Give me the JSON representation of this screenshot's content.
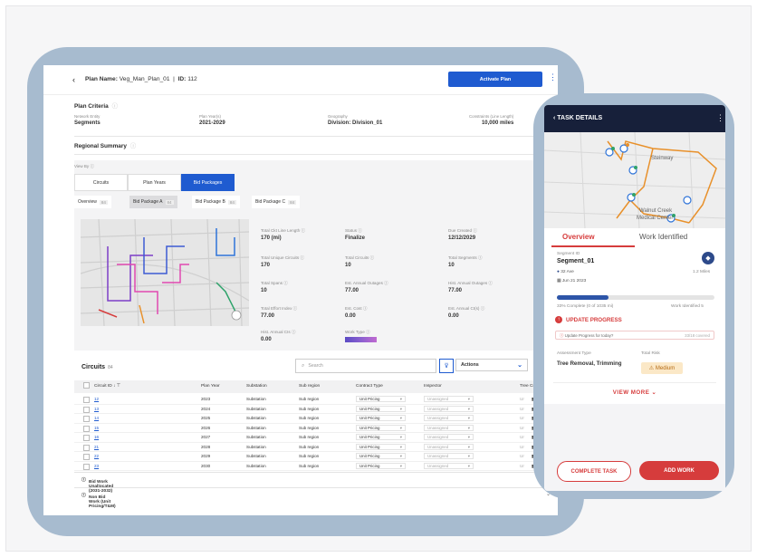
{
  "plan": {
    "back_icon": "chevron-left-icon",
    "name_label": "Plan Name:",
    "name_value": "Veg_Man_Plan_01",
    "id_label": "ID:",
    "id_value": "112",
    "activate_label": "Activate Plan"
  },
  "criteria": {
    "title": "Plan Criteria",
    "items": [
      {
        "label": "Network Entity",
        "value": "Segments"
      },
      {
        "label": "Plan Year(s)",
        "value": "2021-2029"
      },
      {
        "label": "Geography",
        "value": "Division: Division_01"
      },
      {
        "label": "Constraints (Line Length)",
        "value": "10,000 miles"
      }
    ]
  },
  "regional": {
    "title": "Regional Summary",
    "view_by": "View By",
    "view_buttons": [
      "Circuits",
      "Plan Years",
      "Bid Packages"
    ],
    "package_tabs": [
      {
        "label": "Overview",
        "count": "84"
      },
      {
        "label": "Bid Package A",
        "count": "84"
      },
      {
        "label": "Bid Package B",
        "count": "84"
      },
      {
        "label": "Bid Package C",
        "count": "84"
      }
    ],
    "stats": [
      {
        "label": "Total Ckt Line Length",
        "value": "170 (mi)"
      },
      {
        "label": "Status",
        "value": "Finalize"
      },
      {
        "label": "Due Created",
        "value": "12/12/2029"
      },
      {
        "label": "Total Unique Circuits",
        "value": "170"
      },
      {
        "label": "Total Circuits",
        "value": "10"
      },
      {
        "label": "Total Segments",
        "value": "10"
      },
      {
        "label": "Total Spans",
        "value": "10"
      },
      {
        "label": "Est. Annual Outages",
        "value": "77.00"
      },
      {
        "label": "Hist. Annual Outages",
        "value": "77.00"
      },
      {
        "label": "Total Effort Index",
        "value": "77.00"
      },
      {
        "label": "Est. Cost",
        "value": "0.00"
      },
      {
        "label": "Est. Annual CI(s)",
        "value": "0.00"
      },
      {
        "label": "Hist. Annual CIs",
        "value": "0.00"
      },
      {
        "label": "Work Type",
        "value": ""
      }
    ]
  },
  "circuits": {
    "title": "Circuits",
    "count": "84",
    "search_placeholder": "Search",
    "actions_label": "Actions",
    "headers": [
      "Circuit ID",
      "Plan Year",
      "Substation",
      "Sub region",
      "Contract Type",
      "Inspector",
      "Tree Crew"
    ],
    "rows": [
      {
        "id": "12",
        "year": "2023",
        "sub": "Substation",
        "region": "Sub region",
        "contract": "Unit Pricing",
        "inspector": "Unassigned"
      },
      {
        "id": "13",
        "year": "2024",
        "sub": "Substation",
        "region": "Sub region",
        "contract": "Unit Pricing",
        "inspector": "Unassigned"
      },
      {
        "id": "14",
        "year": "2025",
        "sub": "Substation",
        "region": "Sub region",
        "contract": "Unit Pricing",
        "inspector": "Unassigned"
      },
      {
        "id": "15",
        "year": "2026",
        "sub": "Substation",
        "region": "Sub region",
        "contract": "Unit Pricing",
        "inspector": "Unassigned"
      },
      {
        "id": "16",
        "year": "2027",
        "sub": "Substation",
        "region": "Sub region",
        "contract": "Unit Pricing",
        "inspector": "Unassigned"
      },
      {
        "id": "21",
        "year": "2028",
        "sub": "Substation",
        "region": "Sub region",
        "contract": "Unit Pricing",
        "inspector": "Unassigned"
      },
      {
        "id": "22",
        "year": "2029",
        "sub": "Substation",
        "region": "Sub region",
        "contract": "Unit Pricing",
        "inspector": "Unassigned"
      },
      {
        "id": "23",
        "year": "2030",
        "sub": "Substation",
        "region": "Sub region",
        "contract": "Unit Pricing",
        "inspector": "Unassigned"
      }
    ],
    "accordions": [
      "Bid Work Unallocated (2031-2032)",
      "Non Bid Work (Unit Pricing/T&M)"
    ]
  },
  "task": {
    "header": "TASK DETAILS",
    "tab_overview": "Overview",
    "tab_work": "Work Identified",
    "segment_id_label": "Segment ID",
    "segment_id": "Segment_01",
    "address": "32 Ave",
    "distance": "1.2 Miles",
    "date": "Jun 21 2023",
    "progress_text": "33% Complete (0 of 1035 mi)",
    "work_identified": "Work Identified 5",
    "progress_fraction": 0.33,
    "update_label": "UPDATE PROGRESS",
    "update_question": "Update Progress for today?",
    "update_right": "33/18 covered",
    "assessment_label": "Assessment Type",
    "assessment_value": "Tree Removal, Trimming",
    "risk_label": "Total Risk",
    "risk_value": "Medium",
    "view_more": "VIEW MORE",
    "complete_label": "COMPLETE TASK",
    "add_work_label": "ADD WORK",
    "map_labels": [
      "Steinway",
      "Walnut Creek",
      "Medical Center"
    ]
  },
  "colors": {
    "primary": "#1f5bd0",
    "accent_red": "#d63c3c",
    "navy": "#17203a",
    "device_frame": "#a7bbcf"
  }
}
